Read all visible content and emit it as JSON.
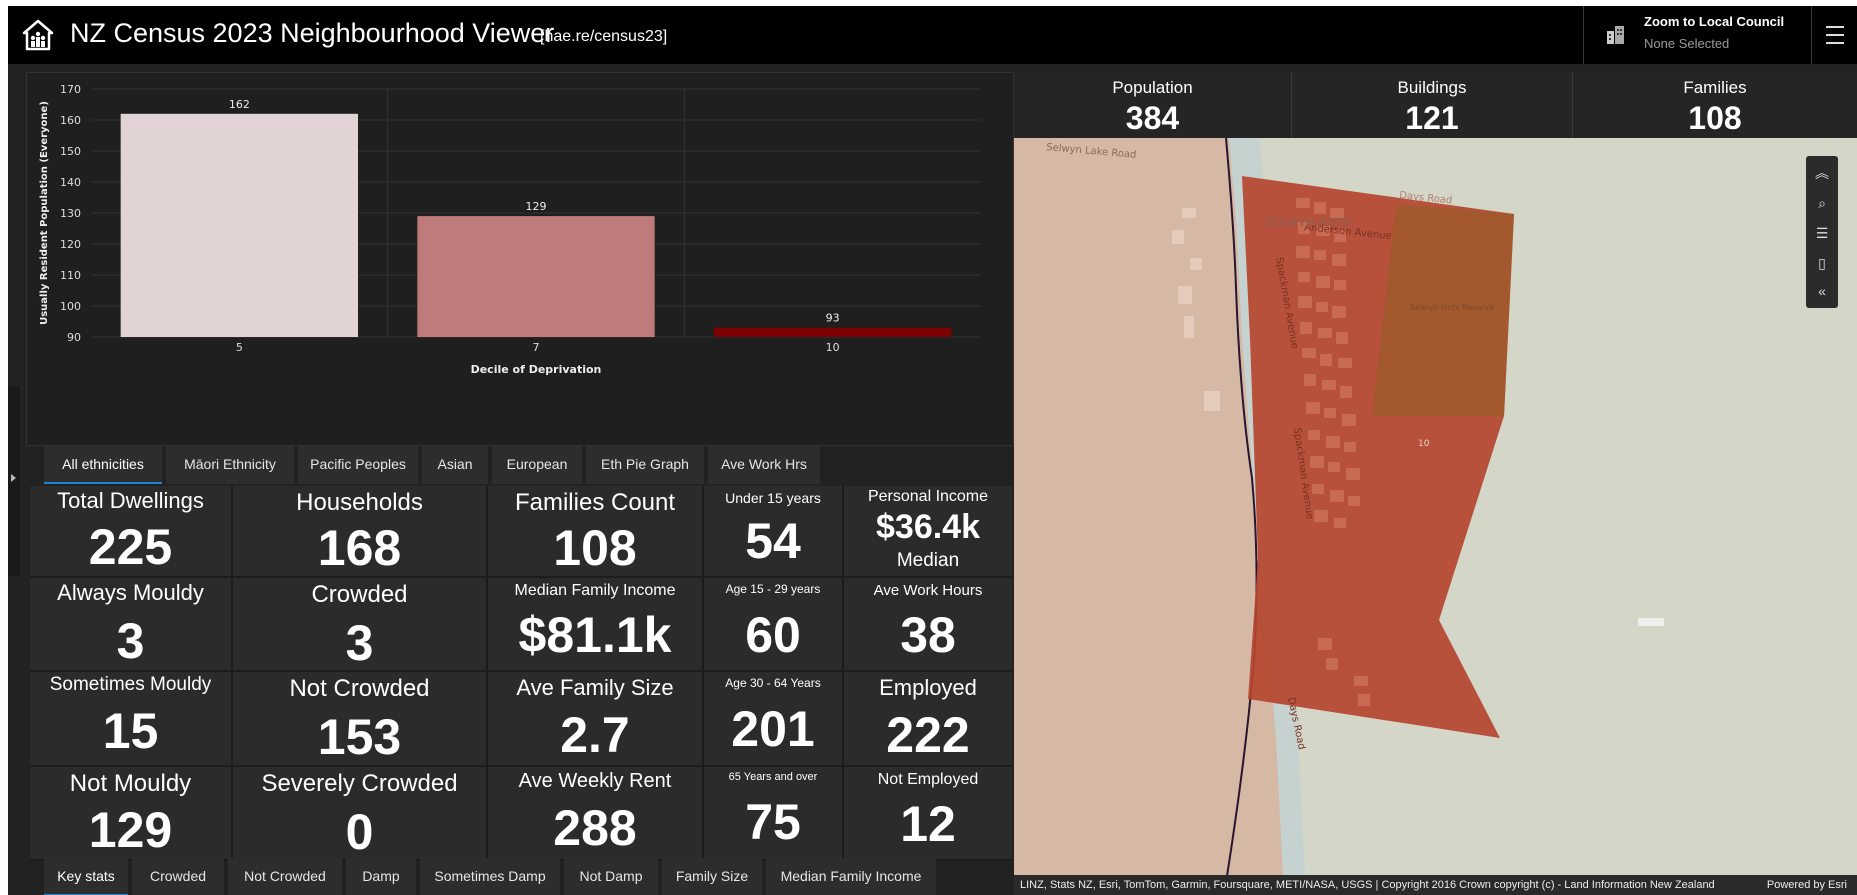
{
  "header": {
    "title": "NZ Census 2023 Neighbourhood Viewer",
    "url": "[hae.re/census23]",
    "zoom_title": "Zoom to Local Council",
    "zoom_value": "None Selected"
  },
  "chart_data": {
    "type": "bar",
    "categories": [
      "5",
      "7",
      "10"
    ],
    "values": [
      162,
      129,
      93
    ],
    "colors": [
      "#e2d4d4",
      "#bf7b7b",
      "#7d0000"
    ],
    "xlabel": "Decile of Deprivation",
    "ylabel": "Usually Resident Population (Everyone)",
    "ylim": [
      90,
      170
    ],
    "yticks": [
      90,
      100,
      110,
      120,
      130,
      140,
      150,
      160,
      170
    ],
    "grid": true
  },
  "ethnicity_tabs": [
    {
      "label": "All ethnicities",
      "active": true
    },
    {
      "label": "Māori Ethnicity",
      "active": false
    },
    {
      "label": "Pacific Peoples",
      "active": false
    },
    {
      "label": "Asian",
      "active": false
    },
    {
      "label": "European",
      "active": false
    },
    {
      "label": "Eth Pie Graph",
      "active": false
    },
    {
      "label": "Ave Work Hrs",
      "active": false
    }
  ],
  "stats": {
    "col1": [
      {
        "label": "Total Dwellings",
        "value": "225"
      },
      {
        "label": "Always Mouldy",
        "value": "3"
      },
      {
        "label": "Sometimes Mouldy",
        "value": "15"
      },
      {
        "label": "Not Mouldy",
        "value": "129"
      }
    ],
    "col2": [
      {
        "label": "Households",
        "value": "168"
      },
      {
        "label": "Crowded",
        "value": "3"
      },
      {
        "label": "Not Crowded",
        "value": "153"
      },
      {
        "label": "Severely Crowded",
        "value": "0"
      }
    ],
    "col3": [
      {
        "label": "Families Count",
        "value": "108"
      },
      {
        "label": "Median Family Income",
        "value": "$81.1k"
      },
      {
        "label": "Ave Family Size",
        "value": "2.7"
      },
      {
        "label": "Ave Weekly Rent",
        "value": "288"
      }
    ],
    "col4": [
      {
        "label": "Under 15 years",
        "value": "54"
      },
      {
        "label": "Age 15 - 29 years",
        "value": "60"
      },
      {
        "label": "Age 30 - 64 Years",
        "value": "201"
      },
      {
        "label": "65 Years and over",
        "value": "75"
      }
    ],
    "col5": [
      {
        "label": "Personal Income",
        "value": "$36.4k",
        "sub": "Median"
      },
      {
        "label": "Ave Work Hours",
        "value": "38"
      },
      {
        "label": "Employed",
        "value": "222"
      },
      {
        "label": "Not Employed",
        "value": "12"
      }
    ]
  },
  "bottom_tabs": [
    {
      "label": "Key stats",
      "active": true
    },
    {
      "label": "Crowded",
      "active": false
    },
    {
      "label": "Not Crowded",
      "active": false
    },
    {
      "label": "Damp",
      "active": false
    },
    {
      "label": "Sometimes Damp",
      "active": false
    },
    {
      "label": "Not Damp",
      "active": false
    },
    {
      "label": "Family Size",
      "active": false
    },
    {
      "label": "Median Family Income",
      "active": false
    }
  ],
  "summary": [
    {
      "label": "Population",
      "value": "384"
    },
    {
      "label": "Buildings",
      "value": "121"
    },
    {
      "label": "Families",
      "value": "108"
    }
  ],
  "map": {
    "labels": {
      "road1": "Selwyn Lake Road",
      "road2": "Days Road",
      "road3": "Anderson Avenue",
      "road4": "Spackman Avenue",
      "road5": "Spackman Avenue",
      "road6": "Days Road",
      "locality": "SELWYN HUTS",
      "reserve": "Selwyn Huts Reserve",
      "decile": "10"
    },
    "attribution": "LINZ, Stats NZ, Esri, TomTom, Garmin, Foursquare, METI/NASA, USGS | Copyright 2016 Crown copyright (c) - Land Information New Zealand",
    "powered_by": "Powered by Esri"
  },
  "colors": {
    "accent": "#1a85d6",
    "header_bg": "#000000",
    "panel_bg": "#222222",
    "polygon_fill": "#b5452f"
  }
}
